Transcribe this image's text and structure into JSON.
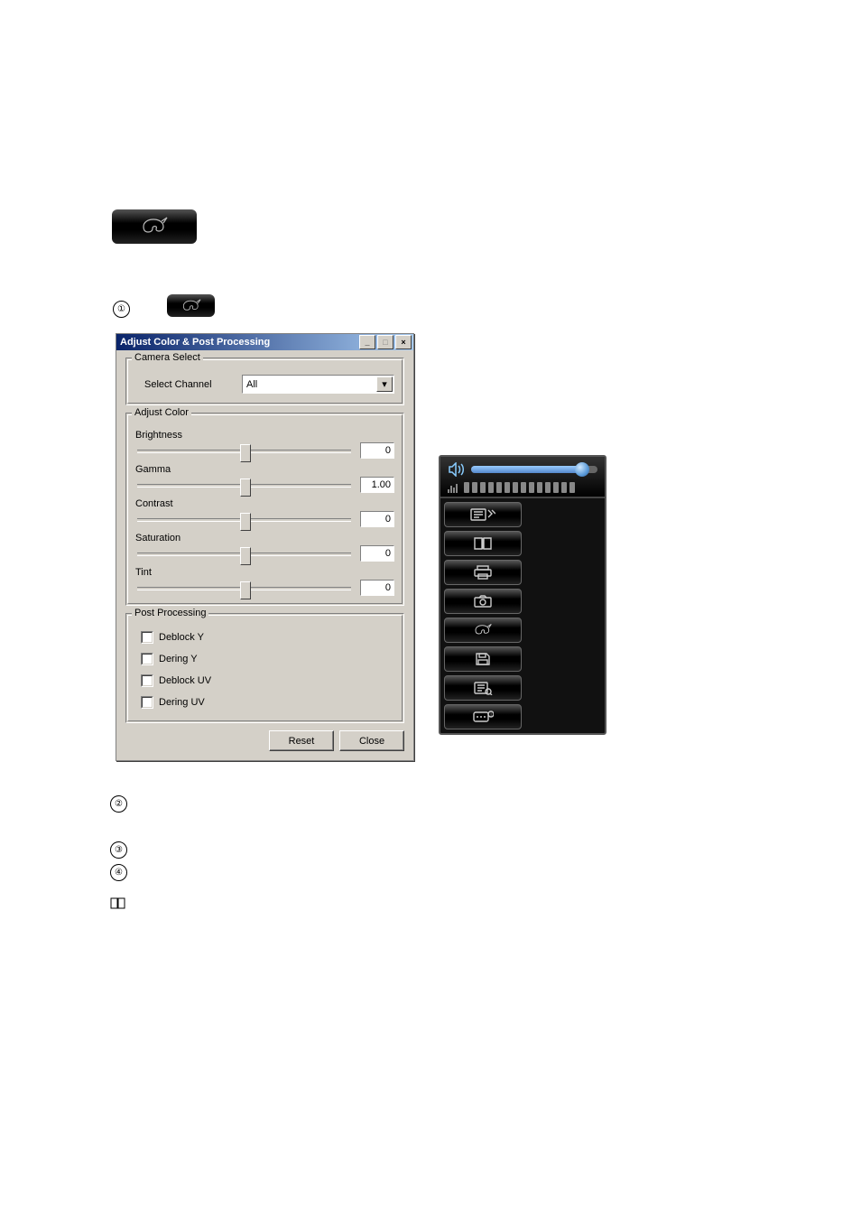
{
  "dialog": {
    "title": "Adjust Color & Post Processing",
    "groups": {
      "camera_select": {
        "legend": "Camera Select",
        "channel_label": "Select Channel",
        "channel_value": "All"
      },
      "adjust_color": {
        "legend": "Adjust Color",
        "sliders": {
          "brightness": {
            "label": "Brightness",
            "value": "0",
            "pos": 50
          },
          "gamma": {
            "label": "Gamma",
            "value": "1.00",
            "pos": 50
          },
          "contrast": {
            "label": "Contrast",
            "value": "0",
            "pos": 50
          },
          "saturation": {
            "label": "Saturation",
            "value": "0",
            "pos": 50
          },
          "tint": {
            "label": "Tint",
            "value": "0",
            "pos": 50
          }
        }
      },
      "post_processing": {
        "legend": "Post Processing",
        "checks": {
          "deblock_y": {
            "label": "Deblock Y",
            "checked": false
          },
          "dering_y": {
            "label": "Dering Y",
            "checked": false
          },
          "deblock_uv": {
            "label": "Deblock UV",
            "checked": false
          },
          "dering_uv": {
            "label": "Dering UV",
            "checked": false
          }
        }
      }
    },
    "buttons": {
      "reset": "Reset",
      "close": "Close"
    }
  },
  "panel": {
    "volume_pct": 88,
    "icons": {
      "events": "events-icon",
      "bookmark": "bookmark-icon",
      "print": "print-icon",
      "camera": "camera-icon",
      "palette": "palette-icon",
      "save": "save-icon",
      "log": "log-icon",
      "osd_info": "osd-info-icon"
    }
  },
  "steps": {
    "s1": "①",
    "s2": "②",
    "s3": "③",
    "s4": "④"
  }
}
